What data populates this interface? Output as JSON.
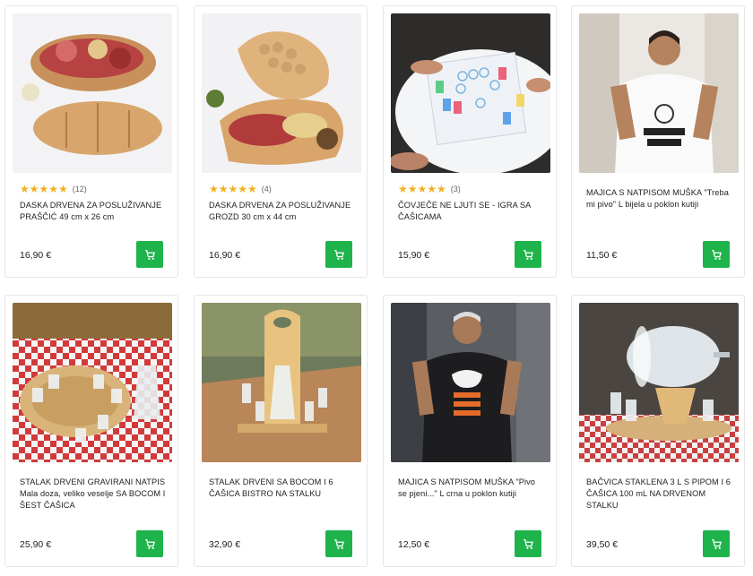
{
  "colors": {
    "accent": "#1fb34c",
    "star": "#f2b01e"
  },
  "products": [
    {
      "image": "pig-serving-board-photo",
      "stars": "★★★★★",
      "reviews": "(12)",
      "title": "DASKA DRVENA ZA POSLUŽIVANJE PRAŠČIĆ 49 cm x 26 cm",
      "price": "16,90 €",
      "cart_icon": "cart-icon"
    },
    {
      "image": "grape-serving-board-photo",
      "stars": "★★★★★",
      "reviews": "(4)",
      "title": "DASKA DRVENA ZA POSLUŽIVANJE GROZD 30 cm x 44 cm",
      "price": "16,90 €",
      "cart_icon": "cart-icon"
    },
    {
      "image": "ludo-shot-glass-game-photo",
      "stars": "★★★★★",
      "reviews": "(3)",
      "title": "ČOVJEČE NE LJUTI SE - IGRA SA ČAŠICAMA",
      "price": "15,90 €",
      "cart_icon": "cart-icon"
    },
    {
      "image": "white-tshirt-model-photo",
      "title": "MAJICA S NATPISOM MUŠKA \"Treba mi pivo\" L bijela u poklon kutiji",
      "price": "11,50 €",
      "cart_icon": "cart-icon"
    },
    {
      "image": "engraved-round-stand-photo",
      "title": "STALAK DRVENI GRAVIRANI NATPIS Mala doza, veliko veselje SA BOCOM I ŠEST ČAŠICA",
      "price": "25,90 €",
      "cart_icon": "cart-icon"
    },
    {
      "image": "wooden-stand-bottle-glasses-photo",
      "title": "STALAK DRVENI SA BOCOM I 6 ČAŠICA BISTRO NA STALKU",
      "price": "32,90 €",
      "cart_icon": "cart-icon"
    },
    {
      "image": "black-tshirt-model-photo",
      "title": "MAJICA S NATPISOM MUŠKA \"Pivo se pjeni...\" L crna u poklon kutiji",
      "price": "12,50 €",
      "cart_icon": "cart-icon"
    },
    {
      "image": "glass-barrel-dispenser-photo",
      "title": "BAČVICA STAKLENA 3 L S PIPOM I 6 ČAŠICA 100 mL NA DRVENOM STALKU",
      "price": "39,50 €",
      "cart_icon": "cart-icon"
    }
  ]
}
